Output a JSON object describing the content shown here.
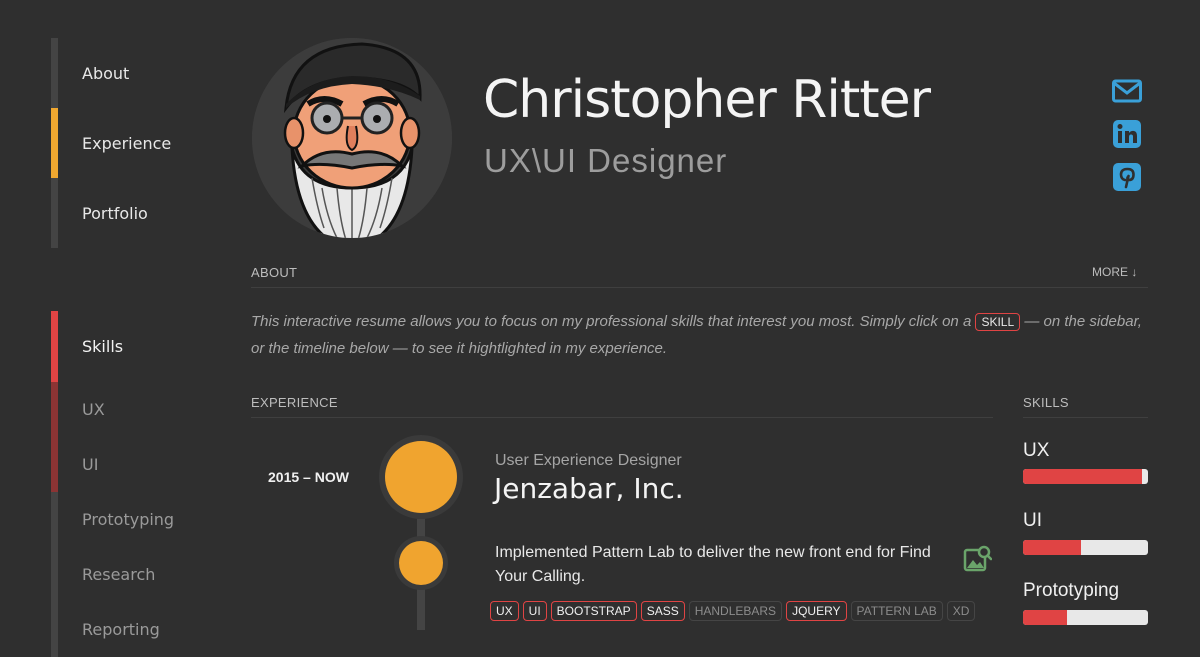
{
  "nav": {
    "items": [
      {
        "label": "About"
      },
      {
        "label": "Experience"
      },
      {
        "label": "Portfolio"
      }
    ]
  },
  "skills_nav": {
    "heading": "Skills",
    "items": [
      {
        "label": "UX"
      },
      {
        "label": "UI"
      },
      {
        "label": "Prototyping"
      },
      {
        "label": "Research"
      },
      {
        "label": "Reporting"
      }
    ]
  },
  "header": {
    "name": "Christopher Ritter",
    "role": "UX\\UI Designer"
  },
  "social": [
    {
      "icon": "mail-icon"
    },
    {
      "icon": "linkedin-icon"
    },
    {
      "icon": "pinterest-icon"
    }
  ],
  "about": {
    "label": "ABOUT",
    "more": "MORE",
    "text_before": "This interactive resume allows you to focus on my professional skills that interest you most. Simply click on a ",
    "chip": "SKILL",
    "text_after": " — on the sidebar, or the timeline below — to see it hightlighted in my experience."
  },
  "experience": {
    "label": "EXPERIENCE",
    "date": "2015 – NOW",
    "job_title": "User Experience Designer",
    "company": "Jenzabar, Inc.",
    "description": "Implemented Pattern Lab to deliver the new front end for Find Your Calling.",
    "tags": [
      {
        "label": "UX",
        "highlighted": true
      },
      {
        "label": "UI",
        "highlighted": true
      },
      {
        "label": "BOOTSTRAP",
        "highlighted": true
      },
      {
        "label": "SASS",
        "highlighted": true
      },
      {
        "label": "HANDLEBARS",
        "highlighted": false
      },
      {
        "label": "JQUERY",
        "highlighted": true
      },
      {
        "label": "PATTERN LAB",
        "highlighted": false
      },
      {
        "label": "XD",
        "highlighted": false
      }
    ]
  },
  "skills_panel": {
    "label": "SKILLS",
    "bars": [
      {
        "label": "UX",
        "level": 0.95
      },
      {
        "label": "UI",
        "level": 0.46
      },
      {
        "label": "Prototyping",
        "level": 0.35
      }
    ]
  },
  "colors": {
    "accent": "#f0a42f",
    "highlight": "#e04444",
    "icon": "#3aa0d8"
  }
}
